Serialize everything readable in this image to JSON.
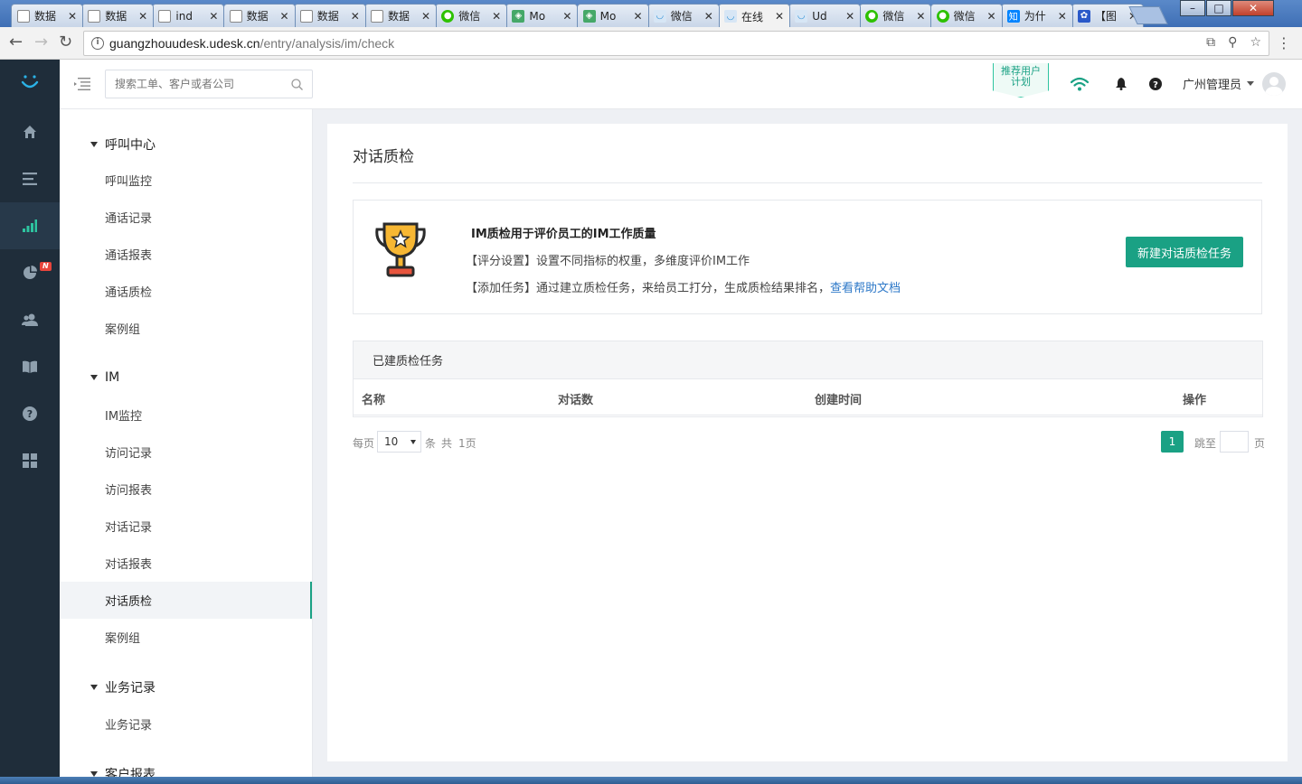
{
  "browser": {
    "tabs": [
      {
        "title": "数据",
        "icon": "doc"
      },
      {
        "title": "数据",
        "icon": "doc"
      },
      {
        "title": "ind",
        "icon": "doc"
      },
      {
        "title": "数据",
        "icon": "doc"
      },
      {
        "title": "数据",
        "icon": "doc"
      },
      {
        "title": "数据",
        "icon": "doc"
      },
      {
        "title": "微信",
        "icon": "wechat"
      },
      {
        "title": "Mo",
        "icon": "green-app"
      },
      {
        "title": "Mo",
        "icon": "green-app"
      },
      {
        "title": "微信",
        "icon": "udesk"
      },
      {
        "title": "在线",
        "icon": "udesk"
      },
      {
        "title": "Ud",
        "icon": "udesk"
      },
      {
        "title": "微信",
        "icon": "wechat"
      },
      {
        "title": "微信",
        "icon": "wechat"
      },
      {
        "title": "为什",
        "icon": "zhihu"
      },
      {
        "title": "【图",
        "icon": "baidu"
      }
    ],
    "active_tab_index": 10,
    "url_host": "guangzhouudesk.udesk.cn",
    "url_path": "/entry/analysis/im/check"
  },
  "topbar": {
    "search_placeholder": "搜索工单、客户或者公司",
    "promo_line1": "推荐用户",
    "promo_line2": "计划",
    "user_name": "广州管理员"
  },
  "nav": {
    "badge": "N",
    "accent_color": "#2ec4a0"
  },
  "sidebar": {
    "groups": [
      {
        "label": "呼叫中心",
        "items": [
          "呼叫监控",
          "通话记录",
          "通话报表",
          "通话质检",
          "案例组"
        ]
      },
      {
        "label": "IM",
        "items": [
          "IM监控",
          "访问记录",
          "访问报表",
          "对话记录",
          "对话报表",
          "对话质检",
          "案例组"
        ]
      },
      {
        "label": "业务记录",
        "items": [
          "业务记录"
        ]
      },
      {
        "label": "客户报表",
        "items": []
      }
    ],
    "active_item": "对话质检"
  },
  "page": {
    "title": "对话质检",
    "intro_heading": "IM质检用于评价员工的IM工作质量",
    "intro_line1": "【评分设置】设置不同指标的权重，多维度评价IM工作",
    "intro_line2": "【添加任务】通过建立质检任务，来给员工打分，生成质检结果排名，",
    "help_link": "查看帮助文档",
    "new_button": "新建对话质检任务",
    "table_title": "已建质检任务",
    "columns": [
      "名称",
      "对话数",
      "创建时间",
      "操作"
    ],
    "pager": {
      "per_page_label": "每页",
      "per_page_value": "10",
      "unit": "条",
      "total_label": "共",
      "total_pages": "1页",
      "current_page": "1",
      "jump_label": "跳至",
      "page_suffix": "页"
    }
  }
}
